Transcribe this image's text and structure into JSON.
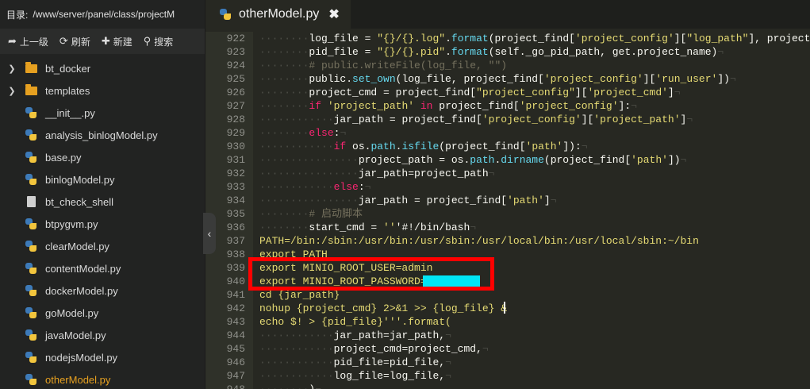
{
  "sidebar": {
    "dir_label": "目录:",
    "dir_path": "/www/server/panel/class/projectM",
    "toolbar": {
      "up": "上一级",
      "refresh": "刷新",
      "new": "新建",
      "search": "搜索"
    },
    "items": [
      {
        "label": "bt_docker",
        "type": "folder"
      },
      {
        "label": "templates",
        "type": "folder"
      },
      {
        "label": "__init__.py",
        "type": "python"
      },
      {
        "label": "analysis_binlogModel.py",
        "type": "python"
      },
      {
        "label": "base.py",
        "type": "python"
      },
      {
        "label": "binlogModel.py",
        "type": "python"
      },
      {
        "label": "bt_check_shell",
        "type": "file"
      },
      {
        "label": "btpygvm.py",
        "type": "python"
      },
      {
        "label": "clearModel.py",
        "type": "python"
      },
      {
        "label": "contentModel.py",
        "type": "python"
      },
      {
        "label": "dockerModel.py",
        "type": "python"
      },
      {
        "label": "goModel.py",
        "type": "python"
      },
      {
        "label": "javaModel.py",
        "type": "python"
      },
      {
        "label": "nodejsModel.py",
        "type": "python"
      },
      {
        "label": "otherModel.py",
        "type": "python",
        "active": true
      }
    ]
  },
  "editor": {
    "tab": {
      "label": "otherModel.py"
    },
    "lines": [
      {
        "n": "922",
        "t": "        log_file = \"{}/{}.log\".format(project_find['project_config'][\"log_path\"], project_f"
      },
      {
        "n": "923",
        "t": "        pid_file = \"{}/{}.pid\".format(self._go_pid_path, get.project_name)"
      },
      {
        "n": "924",
        "t": "        # public.writeFile(log_file, \"\")"
      },
      {
        "n": "925",
        "t": "        public.set_own(log_file, project_find['project_config']['run_user'])"
      },
      {
        "n": "926",
        "t": "        project_cmd = project_find[\"project_config\"]['project_cmd']"
      },
      {
        "n": "927",
        "t": "        if 'project_path' in project_find['project_config']:"
      },
      {
        "n": "928",
        "t": "            jar_path = project_find['project_config']['project_path']"
      },
      {
        "n": "929",
        "t": "        else:"
      },
      {
        "n": "930",
        "t": "            if os.path.isfile(project_find['path']):"
      },
      {
        "n": "931",
        "t": "                project_path = os.path.dirname(project_find['path'])"
      },
      {
        "n": "932",
        "t": "                jar_path=project_path"
      },
      {
        "n": "933",
        "t": "            else:"
      },
      {
        "n": "934",
        "t": "                jar_path = project_find['path']"
      },
      {
        "n": "935",
        "t": "        # 启动脚本"
      },
      {
        "n": "936",
        "t": "        start_cmd = '''#!/bin/bash"
      },
      {
        "n": "937",
        "t": "PATH=/bin:/sbin:/usr/bin:/usr/sbin:/usr/local/bin:/usr/local/sbin:~/bin"
      },
      {
        "n": "938",
        "t": "export PATH"
      },
      {
        "n": "939",
        "t": "export MINIO_ROOT_USER=admin"
      },
      {
        "n": "940",
        "t": "export MINIO_ROOT_PASSWORD="
      },
      {
        "n": "941",
        "t": "cd {jar_path}"
      },
      {
        "n": "942",
        "t": "nohup {project_cmd} 2>&1 >> {log_file} &"
      },
      {
        "n": "943",
        "t": "echo $! > {pid_file}'''.format("
      },
      {
        "n": "944",
        "t": "            jar_path=jar_path,"
      },
      {
        "n": "945",
        "t": "            project_cmd=project_cmd,"
      },
      {
        "n": "946",
        "t": "            pid_file=pid_file,"
      },
      {
        "n": "947",
        "t": "            log_file=log_file,"
      },
      {
        "n": "948",
        "t": "        )"
      }
    ]
  },
  "colors": {
    "editor_bg": "#272822",
    "sidebar_bg": "#222322",
    "keyword": "#f92672",
    "string": "#e6db74",
    "function": "#66d9ef",
    "comment": "#75715e",
    "folder": "#e6a020",
    "active_file": "#e6a020",
    "highlight_box": "#ff0000",
    "redaction": "#00e5f5"
  }
}
